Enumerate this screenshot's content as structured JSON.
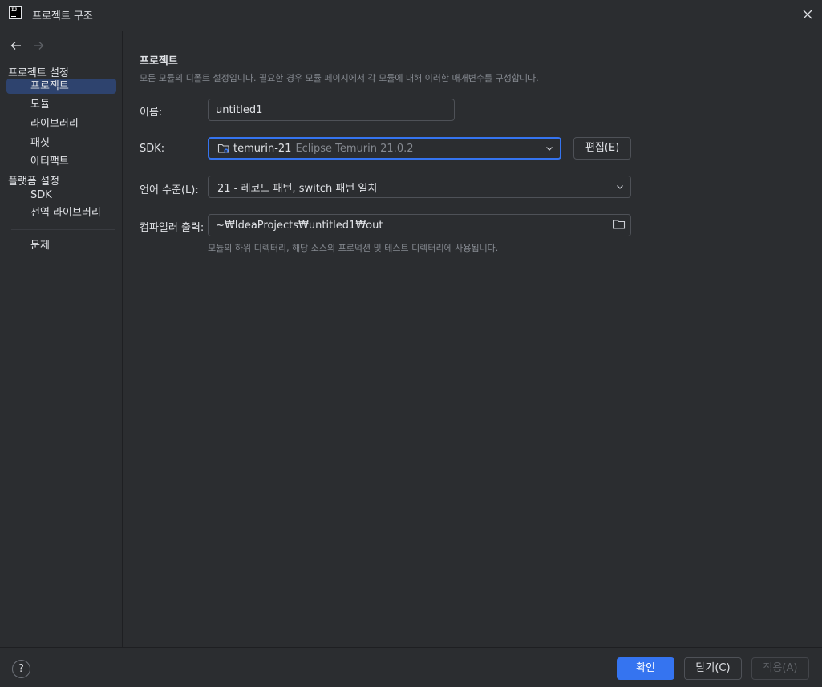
{
  "window": {
    "title": "프로젝트 구조"
  },
  "sidebar": {
    "section_project": "프로젝트 설정",
    "items_project": [
      "프로젝트",
      "모듈",
      "라이브러리",
      "패싯",
      "아티팩트"
    ],
    "section_platform": "플랫폼 설정",
    "items_platform": [
      "SDK",
      "전역 라이브러리"
    ],
    "problems": "문제",
    "selected": "프로젝트"
  },
  "main": {
    "title": "프로젝트",
    "description": "모든 모듈의 디폴트 설정입니다. 필요한 경우 모듈 페이지에서 각 모듈에 대해 이러한 매개변수를 구성합니다.",
    "name_label": "이름:",
    "name_value": "untitled1",
    "sdk_label": "SDK:",
    "sdk_name": "temurin-21",
    "sdk_desc": "Eclipse Temurin 21.0.2",
    "edit_button": "편집(E)",
    "language_label": "언어 수준(L):",
    "language_value": "21 - 레코드 패턴, switch 패턴 일치",
    "compiler_label": "컴파일러 출력:",
    "compiler_value": "~₩IdeaProjects₩untitled1₩out",
    "compiler_hint": "모듈의 하위 디렉터리, 해당 소스의 프로덕션 및 테스트 디렉터리에 사용됩니다."
  },
  "footer": {
    "help": "?",
    "ok": "확인",
    "close": "닫기(C)",
    "apply": "적용(A)"
  },
  "colors": {
    "background": "#2b2d30",
    "selection": "#2e436e",
    "accent": "#3574f0",
    "text": "#dfe1e5",
    "muted": "#868a91"
  },
  "icons": {
    "back": "arrow-left-icon",
    "forward": "arrow-right-icon",
    "close": "close-icon",
    "sdk": "folder-jdk-icon",
    "dropdown": "chevron-down-icon",
    "browse": "folder-icon"
  }
}
